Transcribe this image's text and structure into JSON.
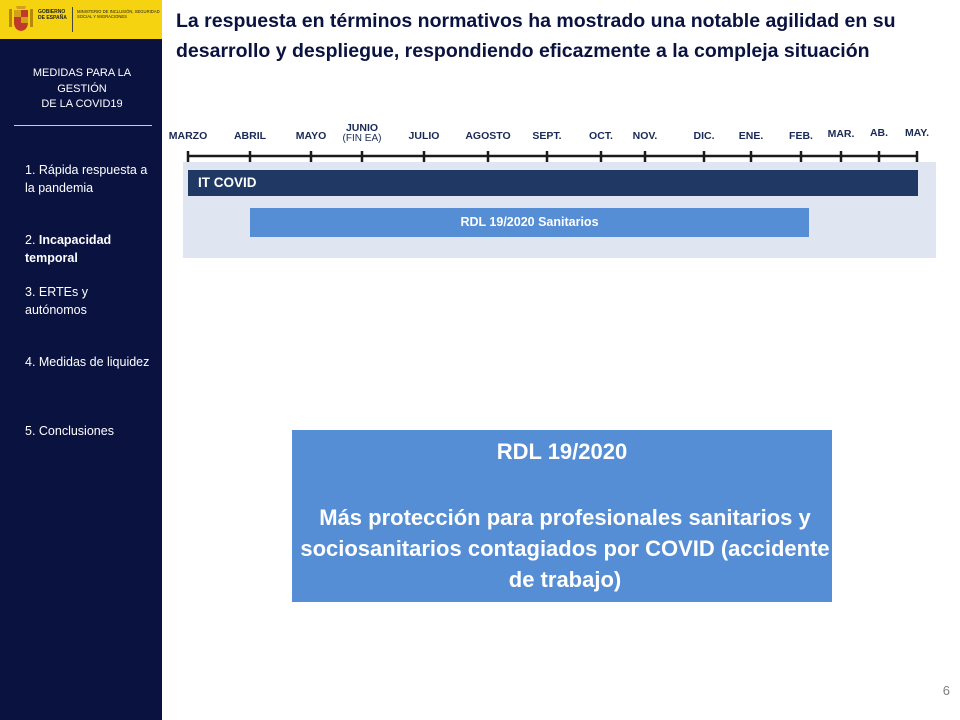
{
  "logo": {
    "gobierno": "GOBIERNO DE ESPAÑA",
    "ministerio": "MINISTERIO DE INCLUSIÓN, SEGURIDAD SOCIAL Y MIGRACIONES"
  },
  "sidebar": {
    "title_lines": [
      "MEDIDAS PARA LA",
      "GESTIÓN",
      "DE LA COVID19"
    ],
    "items": [
      {
        "label": "1. Rápida respuesta a la pandemia"
      },
      {
        "prefix": "2. ",
        "highlight": "Incapacidad temporal"
      },
      {
        "label": "3. ERTEs y autónomos"
      },
      {
        "label": "4. Medidas de liquidez"
      },
      {
        "label": "5. Conclusiones"
      }
    ]
  },
  "headline": "La respuesta en términos normativos ha mostrado una notable agilidad en su desarrollo y despliegue, respondiendo eficazmente a la compleja situación",
  "timeline": {
    "months": [
      "MARZO",
      "ABRIL",
      "MAYO",
      "JUNIO",
      "JULIO",
      "AGOSTO",
      "SEPT.",
      "OCT.",
      "NOV.",
      "DIC.",
      "ENE.",
      "FEB.",
      "MAR.",
      "AB.",
      "MAY."
    ],
    "junio_note": "(FIN EA)",
    "bars": [
      {
        "label": "IT COVID",
        "from": "MARZO",
        "to": "MAY."
      },
      {
        "label": "RDL 19/2020 Sanitarios",
        "from": "ABRIL",
        "to": "FEB."
      }
    ]
  },
  "callout": {
    "title": "RDL 19/2020",
    "body": "Más protección para profesionales sanitarios y sociosanitarios contagiados por COVID (accidente de trabajo)"
  },
  "page_number": "6",
  "colors": {
    "navy": "#0a1240",
    "dark_bar": "#1f3864",
    "blue": "#558ed5",
    "panel": "#dfe6f2",
    "logo_yellow": "#f6d310"
  }
}
